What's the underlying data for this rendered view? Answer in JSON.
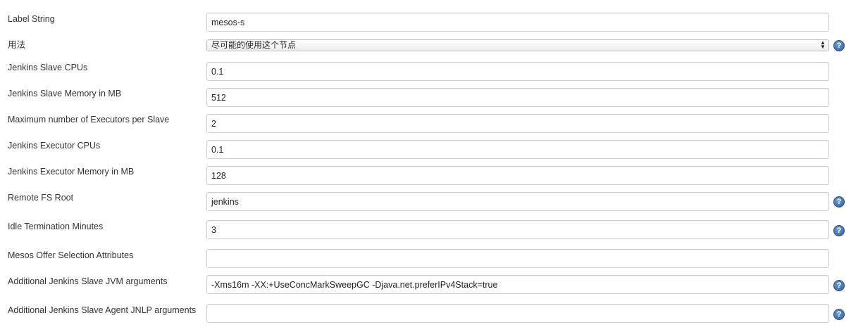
{
  "form": {
    "label_string": {
      "label": "Label String",
      "value": "mesos-s"
    },
    "usage": {
      "label": "用法",
      "selected": "尽可能的使用这个节点",
      "help": "?"
    },
    "slave_cpus": {
      "label": "Jenkins Slave CPUs",
      "value": "0.1"
    },
    "slave_memory": {
      "label": "Jenkins Slave Memory in MB",
      "value": "512"
    },
    "max_executors": {
      "label": "Maximum number of Executors per Slave",
      "value": "2"
    },
    "executor_cpus": {
      "label": "Jenkins Executor CPUs",
      "value": "0.1"
    },
    "executor_memory": {
      "label": "Jenkins Executor Memory in MB",
      "value": "128"
    },
    "remote_fs_root": {
      "label": "Remote FS Root",
      "value": "jenkins",
      "help": "?"
    },
    "idle_termination": {
      "label": "Idle Termination Minutes",
      "value": "3",
      "help": "?"
    },
    "offer_attributes": {
      "label": "Mesos Offer Selection Attributes",
      "value": ""
    },
    "jvm_args": {
      "label": "Additional Jenkins Slave JVM arguments",
      "value": "-Xms16m -XX:+UseConcMarkSweepGC -Djava.net.preferIPv4Stack=true",
      "help": "?"
    },
    "jnlp_args": {
      "label": "Additional Jenkins Slave Agent JNLP arguments",
      "value": "",
      "help": "?"
    }
  },
  "icons": {
    "help": "help-icon",
    "select_arrows": "updown-arrows-icon"
  },
  "colors": {
    "help_icon": "#3b6db0",
    "field_border": "#cccccc",
    "label_text": "#333333"
  }
}
